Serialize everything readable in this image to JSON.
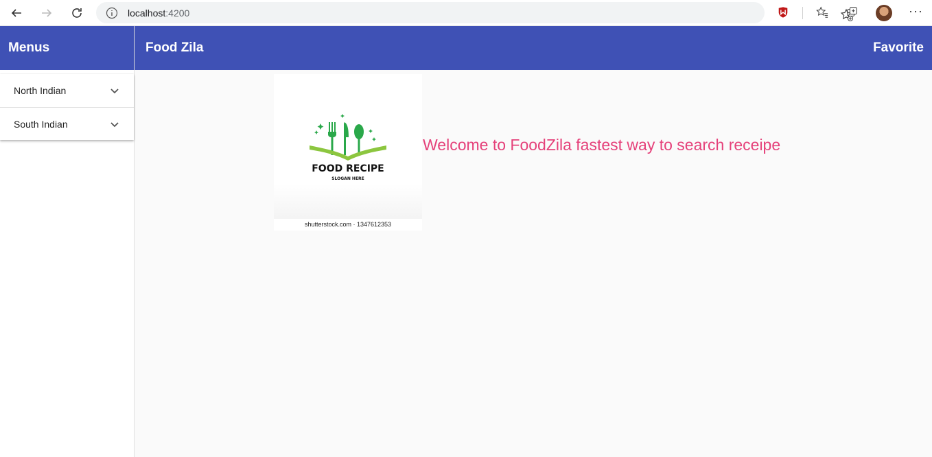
{
  "browser": {
    "url_host": "localhost",
    "url_port": ":4200"
  },
  "sidebar": {
    "title": "Menus",
    "items": [
      {
        "label": "North Indian"
      },
      {
        "label": "South Indian"
      }
    ]
  },
  "toolbar": {
    "title": "Food Zila",
    "favorite_label": "Favorite"
  },
  "main": {
    "logo_title": "FOOD RECIPE",
    "logo_slogan": "SLOGAN HERE",
    "image_caption": "shutterstock.com · 1347612353",
    "welcome_text": "Welcome to FoodZila fastest way to search receipe"
  },
  "colors": {
    "primary": "#3f51b5",
    "accent_text": "#e5417a"
  }
}
